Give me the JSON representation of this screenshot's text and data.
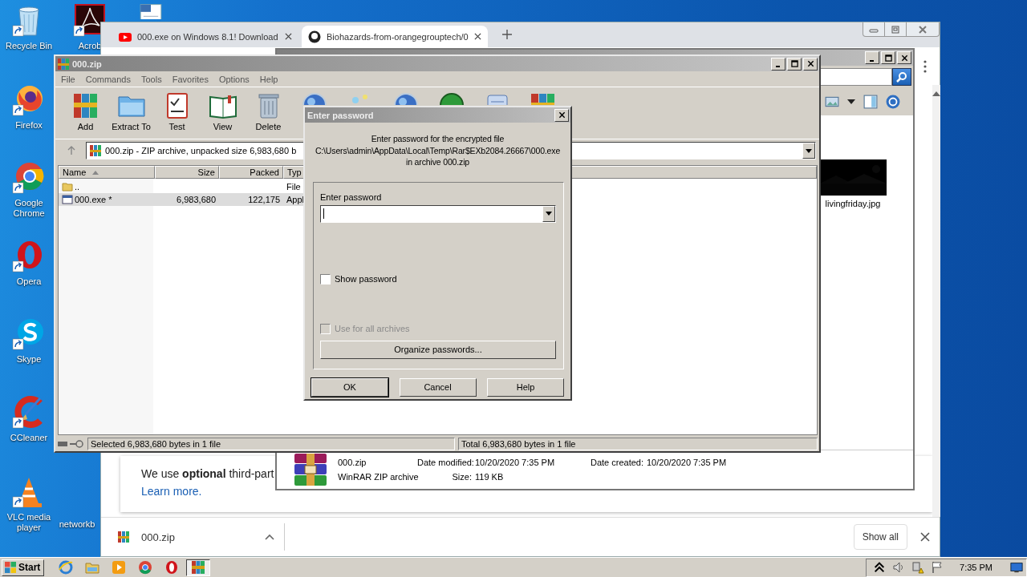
{
  "desktop": {
    "icons": [
      {
        "label": "Recycle Bin",
        "kind": "recycle"
      },
      {
        "label": "Acrob",
        "kind": "acrobat"
      },
      {
        "kind": "document"
      },
      {
        "label": "Firefox",
        "kind": "firefox"
      },
      {
        "label": "Google Chrome",
        "kind": "chrome"
      },
      {
        "label": "Opera",
        "kind": "opera"
      },
      {
        "label": "Skype",
        "kind": "skype"
      },
      {
        "label": "CCleaner",
        "kind": "ccleaner"
      },
      {
        "label": "VLC media player",
        "kind": "vlc"
      },
      {
        "label": "networkb"
      }
    ]
  },
  "browser": {
    "tabs": [
      {
        "title": "000.exe on Windows 8.1! Download",
        "kind": "video",
        "selected": false
      },
      {
        "title": "Biohazards-from-orangegrouptech/0",
        "kind": "repo",
        "selected": true
      }
    ],
    "cookie_notice": "We use **optional** third-part",
    "learn_more": "Learn more.",
    "download": "000.zip",
    "show_all": "Show all"
  },
  "explorer": {
    "thumbnail_label": "livingfriday.jpg",
    "details": {
      "name": "000.zip",
      "type": "WinRAR ZIP archive",
      "modified_label": "Date modified:",
      "modified": "10/20/2020 7:35 PM",
      "size_label": "Size:",
      "size": "119 KB",
      "created_label": "Date created:",
      "created": "10/20/2020 7:35 PM"
    }
  },
  "winrar": {
    "title": "000.zip",
    "menu": [
      "File",
      "Commands",
      "Tools",
      "Favorites",
      "Options",
      "Help"
    ],
    "toolbar": [
      {
        "label": "Add",
        "kind": "add"
      },
      {
        "label": "Extract To",
        "kind": "extract"
      },
      {
        "label": "Test",
        "kind": "test"
      },
      {
        "label": "View",
        "kind": "view"
      },
      {
        "label": "Delete",
        "kind": "delete"
      },
      {
        "kind": "find"
      },
      {
        "kind": "wizard"
      },
      {
        "kind": "info"
      },
      {
        "kind": "virus"
      },
      {
        "kind": "comment"
      },
      {
        "kind": "sfx"
      }
    ],
    "address": "000.zip - ZIP archive, unpacked size 6,983,680 b",
    "columns": [
      "Name",
      "Size",
      "Packed",
      "Typ"
    ],
    "rows": [
      {
        "name": "..",
        "kind": "folder",
        "type": "File",
        "selected": false
      },
      {
        "name": "000.exe *",
        "kind": "exe",
        "size": "6,983,680",
        "packed": "122,175",
        "type": "Appl",
        "selected": true
      }
    ],
    "status_selected": "Selected 6,983,680 bytes in 1 file",
    "status_total": "Total 6,983,680 bytes in 1 file"
  },
  "password_dialog": {
    "title": "Enter password",
    "message": [
      "Enter password for the encrypted file",
      "C:\\Users\\admin\\AppData\\Local\\Temp\\Rar$EXb2084.26667\\000.exe",
      "in archive 000.zip"
    ],
    "field_label": "Enter password",
    "options": [
      {
        "label": "Show password",
        "checked": false,
        "disabled": false
      },
      {
        "label": "Use for all archives",
        "checked": false,
        "disabled": true
      }
    ],
    "organize": "Organize passwords...",
    "buttons": [
      {
        "label": "OK",
        "default": true
      },
      {
        "label": "Cancel",
        "default": false
      },
      {
        "label": "Help",
        "default": false
      }
    ]
  },
  "taskbar": {
    "start": "Start",
    "apps": [
      {
        "kind": "browser-e",
        "active": false
      },
      {
        "kind": "folder",
        "active": false
      },
      {
        "kind": "media",
        "active": false
      },
      {
        "kind": "chrome",
        "active": false
      },
      {
        "kind": "opera",
        "active": false
      },
      {
        "kind": "winrar",
        "active": true
      }
    ],
    "clock": "7:35 PM"
  }
}
